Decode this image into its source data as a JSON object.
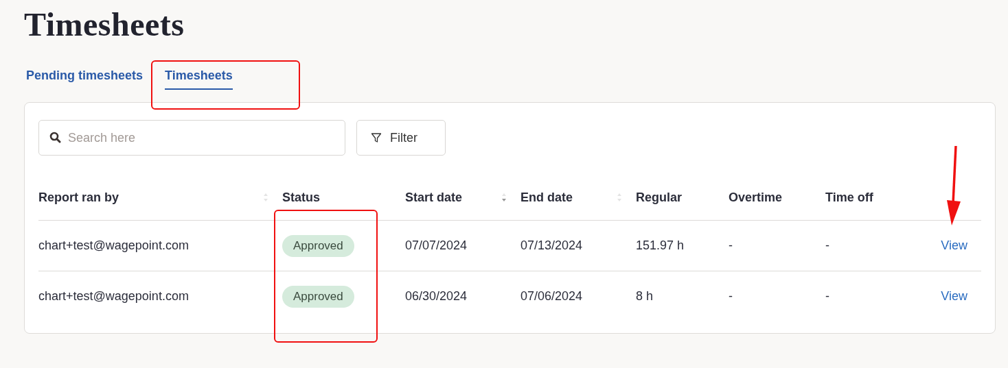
{
  "title": "Timesheets",
  "tabs": [
    {
      "label": "Pending timesheets",
      "selected": false
    },
    {
      "label": "Timesheets",
      "selected": true
    }
  ],
  "search": {
    "placeholder": "Search here"
  },
  "filter_button": "Filter",
  "table": {
    "columns": [
      {
        "label": "Report ran by",
        "sortable": true,
        "sorted_descending": false
      },
      {
        "label": "Status"
      },
      {
        "label": "Start date",
        "sortable": true,
        "sorted_descending": true
      },
      {
        "label": "End date",
        "sortable": true,
        "sorted_descending": false
      },
      {
        "label": "Regular"
      },
      {
        "label": "Overtime"
      },
      {
        "label": "Time off"
      }
    ],
    "rows": [
      {
        "cells": [
          "chart+test@wagepoint.com",
          "Approved",
          "07/07/2024",
          "07/13/2024",
          "151.97 h",
          "-",
          "-"
        ],
        "action": "View"
      },
      {
        "cells": [
          "chart+test@wagepoint.com",
          "Approved",
          "06/30/2024",
          "07/06/2024",
          "8 h",
          "-",
          "-"
        ],
        "action": "View"
      }
    ]
  }
}
